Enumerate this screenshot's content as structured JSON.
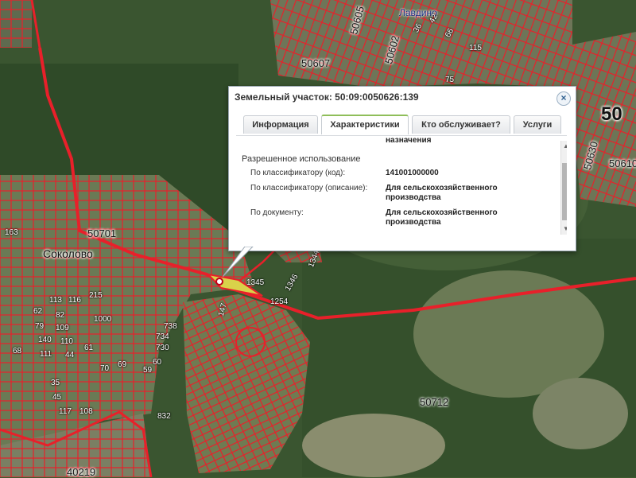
{
  "map": {
    "town_label": "Лавдино",
    "village_label": "Соколово",
    "big_label": "50",
    "quarters": [
      "50605",
      "50602",
      "50607",
      "50701",
      "50712",
      "50630",
      "50610",
      "40219"
    ],
    "plots": [
      "163",
      "115",
      "75",
      "113",
      "116",
      "215",
      "62",
      "82",
      "1000",
      "79",
      "109",
      "140",
      "110",
      "111",
      "44",
      "69",
      "70",
      "68",
      "35",
      "45",
      "117",
      "108",
      "738",
      "734",
      "730",
      "59",
      "60",
      "61",
      "832",
      "1345",
      "1346",
      "1344",
      "1254",
      "147",
      "42",
      "36",
      "66"
    ],
    "colors": {
      "parcel_border": "#e8202a",
      "road": "#e8202a",
      "highlight": "#d9d24a"
    }
  },
  "popup": {
    "title": "Земельный участок: 50:09:0050626:139",
    "close_icon": "close-icon",
    "tabs": [
      "Информация",
      "Характеристики",
      "Кто обслуживает?",
      "Услуги"
    ],
    "active_tab": "Характеристики",
    "cut_text": "назначения",
    "section": "Разрешенное использование",
    "rows": [
      {
        "label": "По классификатору (код):",
        "value": "141001000000"
      },
      {
        "label": "По классификатору (описание):",
        "value": "Для сельскохозяйственного производства"
      },
      {
        "label": "По документу:",
        "value": "Для сельскохозяйственного производства"
      }
    ]
  }
}
